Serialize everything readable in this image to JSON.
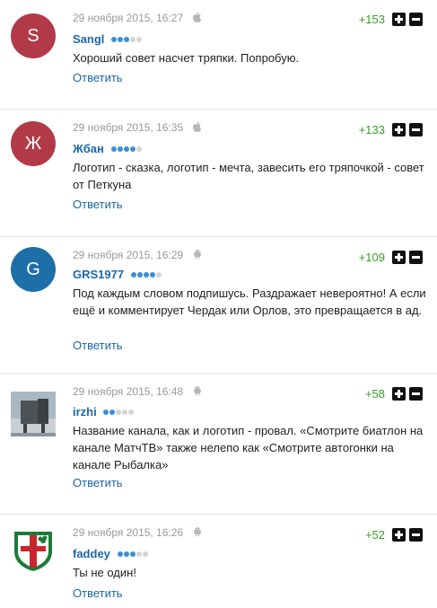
{
  "reply_label": "Ответить",
  "comments": [
    {
      "initial": "S",
      "avatar_color": "#b23a48",
      "avatar_type": "letter",
      "date": "29 ноября 2015, 16:27",
      "os": "apple-icon",
      "author": "Sangl",
      "rating_level": 3,
      "score": "+153",
      "text": "Хороший совет насчет тряпки. Попробую."
    },
    {
      "initial": "Ж",
      "avatar_color": "#b23a48",
      "avatar_type": "letter",
      "date": "29 ноября 2015, 16:35",
      "os": "apple-icon",
      "author": "Жбан",
      "rating_level": 4,
      "score": "+133",
      "text": "Логотип - сказка, логотип - мечта, завесить его тряпочкой - совет от Петкуна"
    },
    {
      "initial": "G",
      "avatar_color": "#1e6fa8",
      "avatar_type": "letter",
      "date": "29 ноября 2015, 16:29",
      "os": "android-icon",
      "author": "GRS1977",
      "rating_level": 4,
      "score": "+109",
      "text": "Под каждым словом подпишусь. Раздражает невероятно! А если ещё и комментирует Чердак или Орлов, это превращается в ад."
    },
    {
      "initial": "",
      "avatar_color": "#7c8c98",
      "avatar_type": "photo-monument",
      "date": "29 ноября 2015, 16:48",
      "os": "android-icon",
      "author": "irzhi",
      "rating_level": 2,
      "score": "+58",
      "text": "Название канала, как и логотип - провал. «Смотрите биатлон на канале МатчТВ» также нелепо как «Смотрите автогонки на канале Рыбалка»"
    },
    {
      "initial": "",
      "avatar_color": "#1f7a3a",
      "avatar_type": "crest",
      "date": "29 ноября 2015, 16:26",
      "os": "android-icon",
      "author": "faddey",
      "rating_level": 3,
      "score": "+52",
      "text": "Ты не один!"
    }
  ]
}
